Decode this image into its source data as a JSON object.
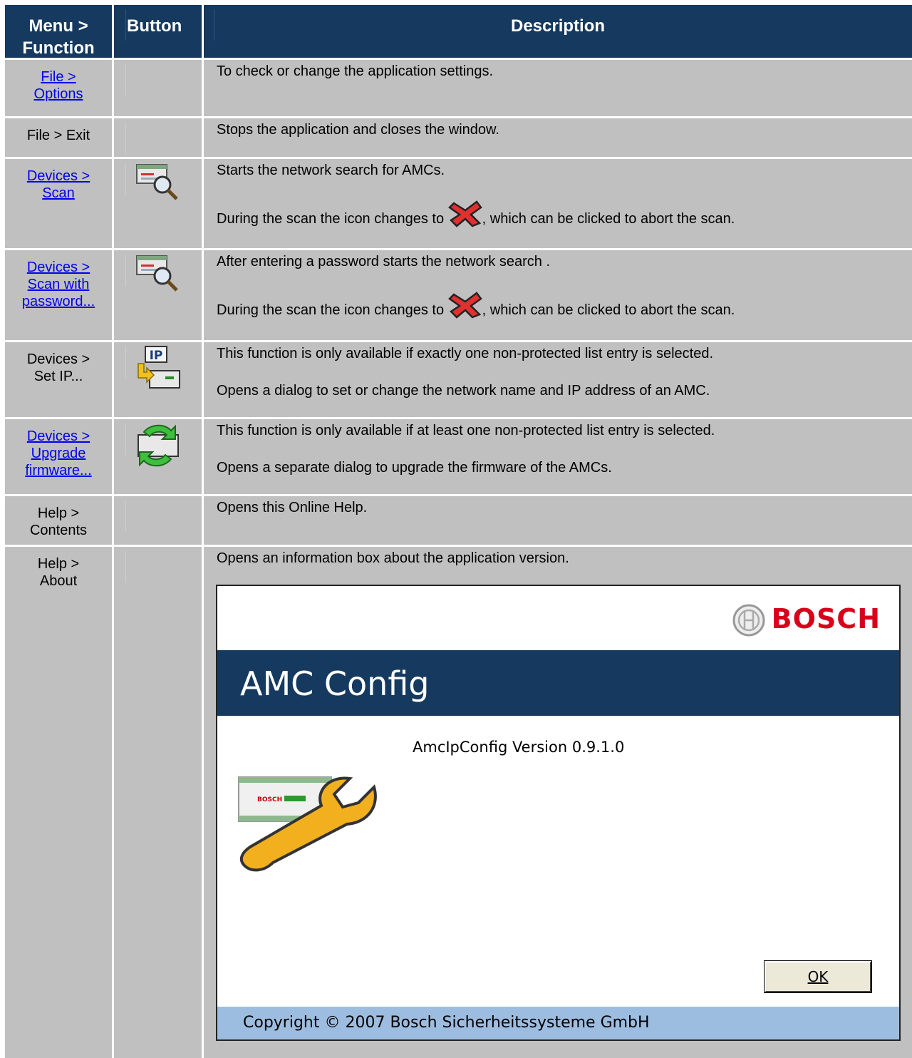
{
  "header": {
    "menu_function": "Menu > Function",
    "button": "Button",
    "description": "Description"
  },
  "rows": [
    {
      "menu": "File > Options",
      "is_link": true,
      "icon": "",
      "desc": [
        "To check or change the application settings."
      ]
    },
    {
      "menu": "File > Exit",
      "is_link": false,
      "icon": "",
      "desc": [
        "Stops the application and closes the window."
      ]
    },
    {
      "menu": "Devices > Scan",
      "is_link": true,
      "icon": "scan-icon",
      "desc": [
        "Starts the network search for AMCs.",
        "During the scan the icon changes to",
        ", which can be clicked to abort the scan."
      ]
    },
    {
      "menu": "Devices > Scan with password...",
      "is_link": true,
      "icon": "scan-icon",
      "desc": [
        "After entering a password starts the network search .",
        "During the scan the icon changes to",
        ", which can be clicked to abort the scan."
      ]
    },
    {
      "menu": "Devices > Set IP...",
      "is_link": false,
      "icon": "set-ip-icon",
      "icon_text": "IP",
      "desc": [
        "This function is only available if exactly one non-protected list entry is selected.",
        "Opens a dialog to set or change the network name and IP address of an AMC."
      ]
    },
    {
      "menu": "Devices > Upgrade firmware...",
      "is_link": true,
      "icon": "upgrade-firmware-icon",
      "desc": [
        "This function is only available if at least one non-protected list entry is selected.",
        "Opens a separate dialog to upgrade the firmware of the AMCs."
      ]
    },
    {
      "menu": "Help > Contents",
      "is_link": false,
      "icon": "",
      "desc": [
        "Opens this Online Help."
      ]
    },
    {
      "menu": "Help > About",
      "is_link": false,
      "icon": "",
      "desc": [
        "Opens an information box about the application version."
      ]
    }
  ],
  "menu_lines": {
    "r0": [
      "File >",
      "Options"
    ],
    "r1": [
      "File > Exit"
    ],
    "r2": [
      "Devices >",
      "Scan"
    ],
    "r3": [
      "Devices >",
      "Scan with",
      "password..."
    ],
    "r4": [
      "Devices >",
      "Set IP..."
    ],
    "r5": [
      "Devices >",
      "Upgrade",
      "firmware..."
    ],
    "r6": [
      "Help >",
      "Contents"
    ],
    "r7": [
      "Help >",
      "About"
    ]
  },
  "about_dialog": {
    "brand": "BOSCH",
    "title": "AMC Config",
    "version": "AmcIpConfig Version 0.9.1.0",
    "ok_label": "OK",
    "copyright": "Copyright © 2007 Bosch Sicherheitssysteme GmbH",
    "device_label": "BOSCH"
  },
  "colors": {
    "header_bg": "#163a5f",
    "cell_bg": "#c0c0c0",
    "link": "#0000ee",
    "brand_red": "#d9001a",
    "copyright_bg": "#9dbde0"
  }
}
